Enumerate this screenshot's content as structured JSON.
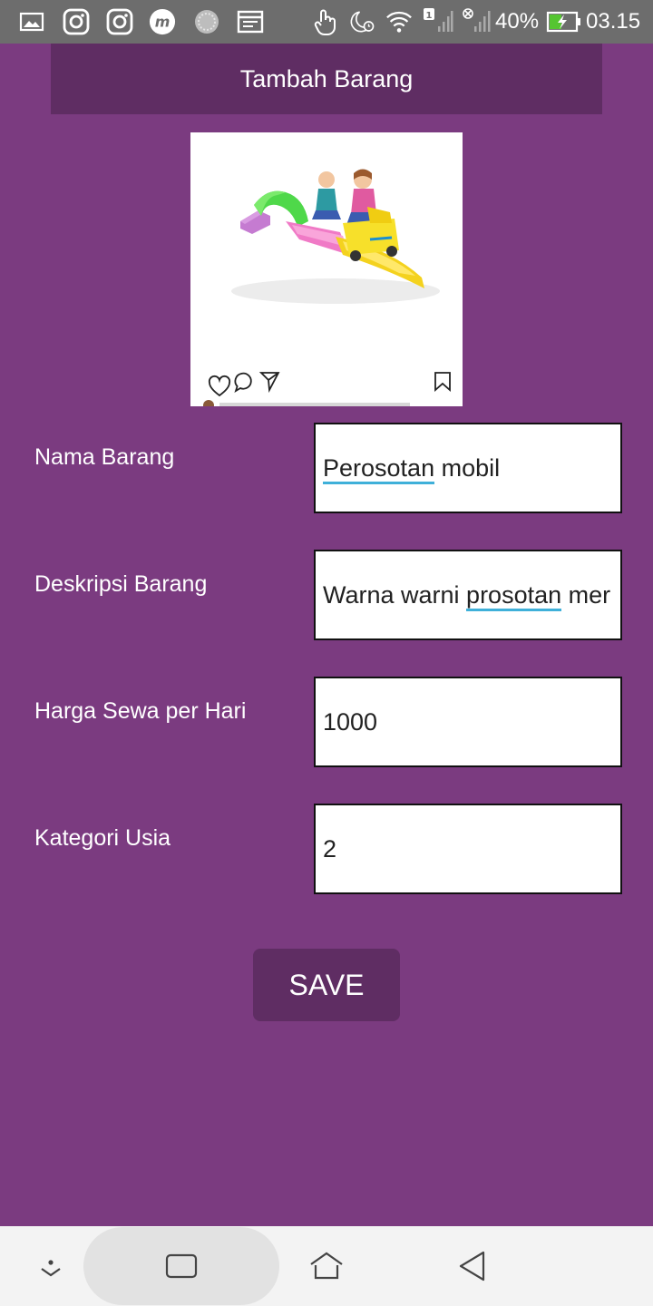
{
  "status_bar": {
    "battery_percent": "40%",
    "time": "03.15",
    "sim_badge": "1",
    "icons": [
      "gallery-icon",
      "instagram-icon",
      "instagram-icon",
      "messenger-m-icon",
      "circle-app-icon",
      "calendar-icon",
      "touch-icon",
      "night-alarm-icon",
      "wifi-icon",
      "signal-icon",
      "no-signal-icon",
      "battery-charging-icon"
    ]
  },
  "header": {
    "title": "Tambah Barang"
  },
  "form": {
    "name_label": "Nama Barang",
    "name_value_word1": "Perosotan",
    "name_value_rest": " mobil",
    "desc_label": "Deskripsi Barang",
    "desc_value_pre": "Warna warni ",
    "desc_value_word": "prosotan",
    "desc_value_post": " mer",
    "price_label": "Harga Sewa per Hari",
    "price_value": "1000",
    "age_label": "Kategori Usia",
    "age_value": "2"
  },
  "actions": {
    "save_label": "SAVE"
  },
  "nav_bar": {
    "icons": [
      "collapse-down-icon",
      "recent-apps-icon",
      "home-icon",
      "back-icon"
    ]
  },
  "colors": {
    "background": "#7b3b80",
    "header_bg": "#5f2d63",
    "button_bg": "#5f2d63",
    "spell_underline": "#3fb0d9"
  }
}
